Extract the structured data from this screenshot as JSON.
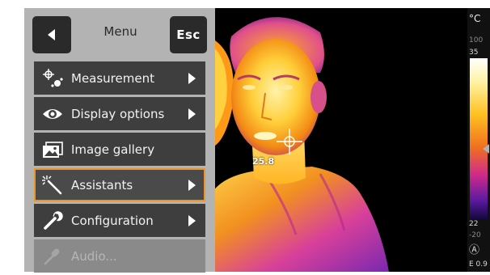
{
  "header": {
    "title": "Menu",
    "esc_label": "Esc"
  },
  "menu": {
    "items": [
      {
        "label": "Measurement",
        "icon": "crosshair-measure-icon",
        "has_submenu": true,
        "state": "normal"
      },
      {
        "label": "Display options",
        "icon": "eye-icon",
        "has_submenu": true,
        "state": "normal"
      },
      {
        "label": "Image gallery",
        "icon": "image-gallery-icon",
        "has_submenu": false,
        "state": "normal"
      },
      {
        "label": "Assistants",
        "icon": "magic-wand-icon",
        "has_submenu": true,
        "state": "selected"
      },
      {
        "label": "Configuration",
        "icon": "wrench-icon",
        "has_submenu": true,
        "state": "normal"
      },
      {
        "label": "Audio...",
        "icon": "microphone-icon",
        "has_submenu": false,
        "state": "disabled"
      }
    ]
  },
  "thermal": {
    "spot_temperature": "25.8"
  },
  "scale": {
    "unit": "°C",
    "range_max": "100",
    "upper": "35",
    "lower": "22",
    "range_min": "-20",
    "mode_symbol": "Ⓐ",
    "emissivity": "E 0.9"
  },
  "colors": {
    "selected_outline": "#e8962a",
    "panel_bg": "#b3b3b3",
    "item_bg": "#3e3e3e"
  }
}
